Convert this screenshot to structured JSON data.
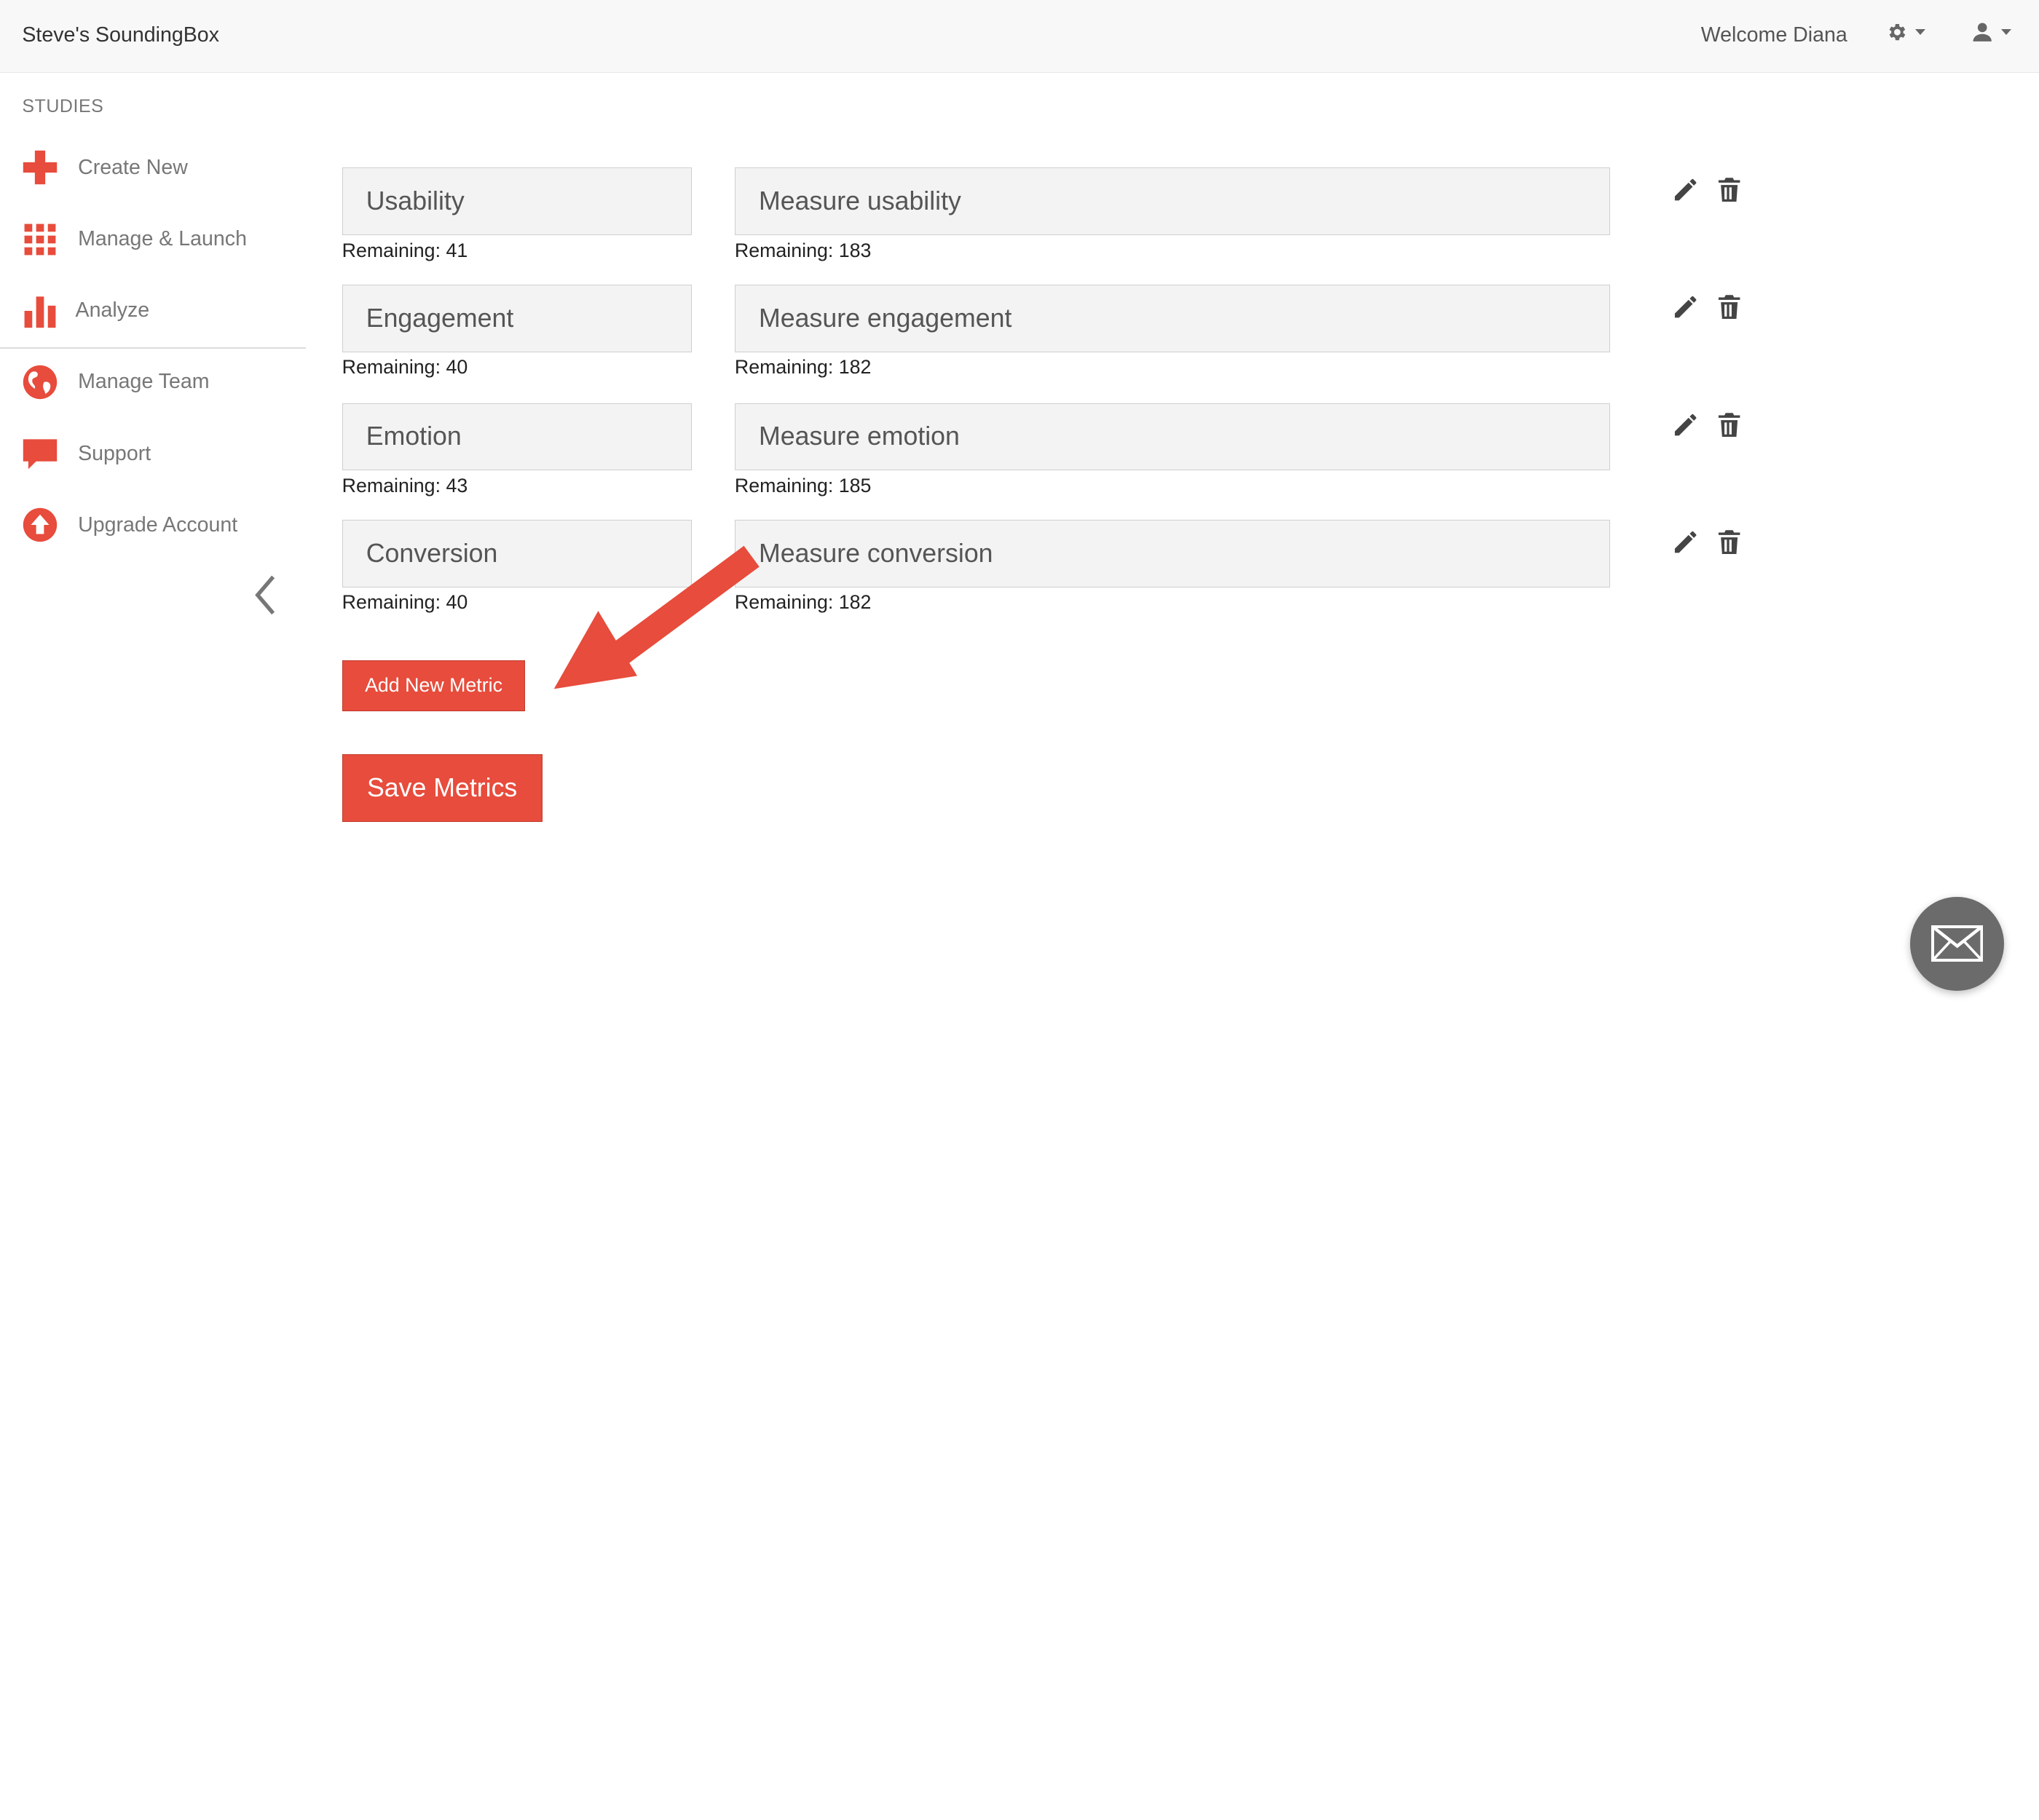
{
  "header": {
    "brand": "Steve's SoundingBox",
    "welcome": "Welcome Diana"
  },
  "sidebar": {
    "section_title": "STUDIES",
    "items": [
      {
        "label": "Create New",
        "icon": "plus-icon"
      },
      {
        "label": "Manage & Launch",
        "icon": "grid-icon"
      },
      {
        "label": "Analyze",
        "icon": "bar-chart-icon"
      },
      {
        "label": "Manage Team",
        "icon": "globe-icon"
      },
      {
        "label": "Support",
        "icon": "speech-bubble-icon"
      },
      {
        "label": "Upgrade Account",
        "icon": "upload-circle-icon"
      }
    ]
  },
  "metrics": [
    {
      "name": "Usability",
      "description": "Measure usability",
      "name_remaining": "Remaining: 41",
      "desc_remaining": "Remaining: 183"
    },
    {
      "name": "Engagement",
      "description": "Measure engagement",
      "name_remaining": "Remaining: 40",
      "desc_remaining": "Remaining: 182"
    },
    {
      "name": "Emotion",
      "description": "Measure emotion",
      "name_remaining": "Remaining: 43",
      "desc_remaining": "Remaining: 185"
    },
    {
      "name": "Conversion",
      "description": "Measure conversion",
      "name_remaining": "Remaining: 40",
      "desc_remaining": "Remaining: 182"
    }
  ],
  "buttons": {
    "add_metric": "Add New Metric",
    "save_metrics": "Save Metrics"
  },
  "colors": {
    "accent": "#e74c3c",
    "icon_dark": "#444444"
  }
}
